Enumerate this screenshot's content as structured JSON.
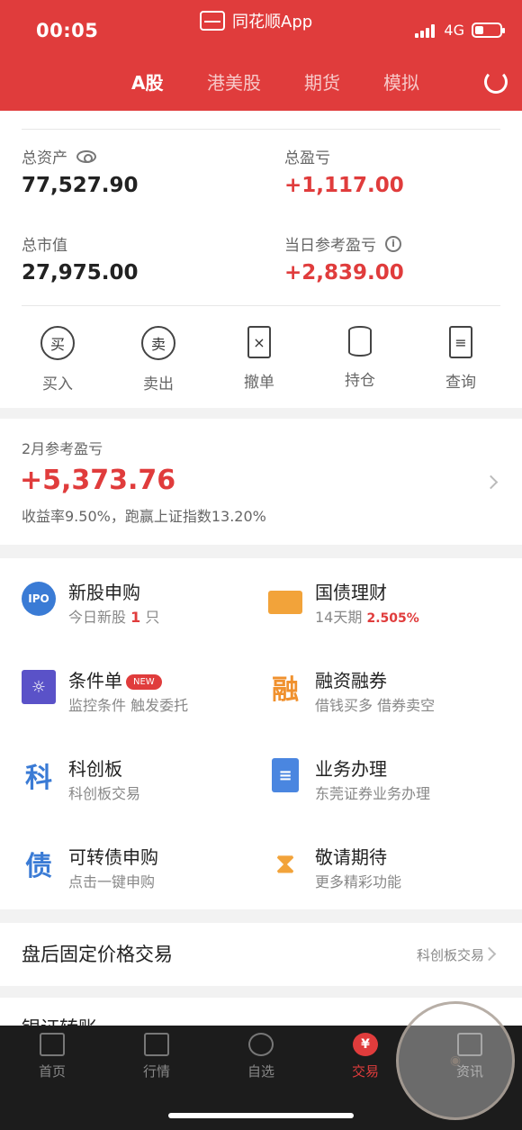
{
  "status_bar": {
    "time": "00:05",
    "app_title": "同花顺App",
    "network": "4G"
  },
  "tabs": [
    "A股",
    "港美股",
    "期货",
    "模拟"
  ],
  "assets": {
    "total_assets_label": "总资产",
    "total_assets_value": "77,527.90",
    "total_pl_label": "总盈亏",
    "total_pl_value": "+1,117.00",
    "market_value_label": "总市值",
    "market_value_value": "27,975.00",
    "daily_pl_label": "当日参考盈亏",
    "daily_pl_value": "+2,839.00"
  },
  "actions": [
    {
      "icon_text": "买",
      "label": "买入"
    },
    {
      "icon_text": "卖",
      "label": "卖出"
    },
    {
      "icon_text": "×",
      "label": "撤单"
    },
    {
      "icon_text": "",
      "label": "持仓"
    },
    {
      "icon_text": "≡",
      "label": "查询"
    }
  ],
  "monthly": {
    "label": "2月参考盈亏",
    "value": "+5,373.76",
    "desc": "收益率9.50%，跑赢上证指数13.20%"
  },
  "services": [
    {
      "icon": "IPO",
      "title": "新股申购",
      "sub_prefix": "今日新股",
      "sub_highlight": "1",
      "sub_suffix": "只"
    },
    {
      "icon": "",
      "title": "国债理财",
      "sub_prefix": "14天期",
      "sub_highlight": "2.505%",
      "sub_suffix": ""
    },
    {
      "icon": "",
      "title": "条件单",
      "badge": "NEW",
      "sub_prefix": "监控条件 触发委托",
      "sub_highlight": "",
      "sub_suffix": ""
    },
    {
      "icon": "融",
      "title": "融资融券",
      "sub_prefix": "借钱买多 借券卖空",
      "sub_highlight": "",
      "sub_suffix": ""
    },
    {
      "icon": "科",
      "title": "科创板",
      "sub_prefix": "科创板交易",
      "sub_highlight": "",
      "sub_suffix": ""
    },
    {
      "icon": "",
      "title": "业务办理",
      "sub_prefix": "东莞证券业务办理",
      "sub_highlight": "",
      "sub_suffix": ""
    },
    {
      "icon": "债",
      "title": "可转债申购",
      "sub_prefix": "点击一键申购",
      "sub_highlight": "",
      "sub_suffix": ""
    },
    {
      "icon": "",
      "title": "敬请期待",
      "sub_prefix": "更多精彩功能",
      "sub_highlight": "",
      "sub_suffix": ""
    }
  ],
  "after_hours": {
    "title": "盘后固定价格交易",
    "link": "科创板交易"
  },
  "bank_transfer": {
    "title": "银证转账"
  },
  "bottom_nav": [
    {
      "label": "首页",
      "icon_text": ""
    },
    {
      "label": "行情",
      "icon_text": ""
    },
    {
      "label": "自选",
      "icon_text": ""
    },
    {
      "label": "交易",
      "icon_text": "¥"
    },
    {
      "label": "资讯",
      "icon_text": ""
    }
  ],
  "colors": {
    "brand_red": "#e03c3c",
    "dark_nav": "#1c1c1c"
  }
}
